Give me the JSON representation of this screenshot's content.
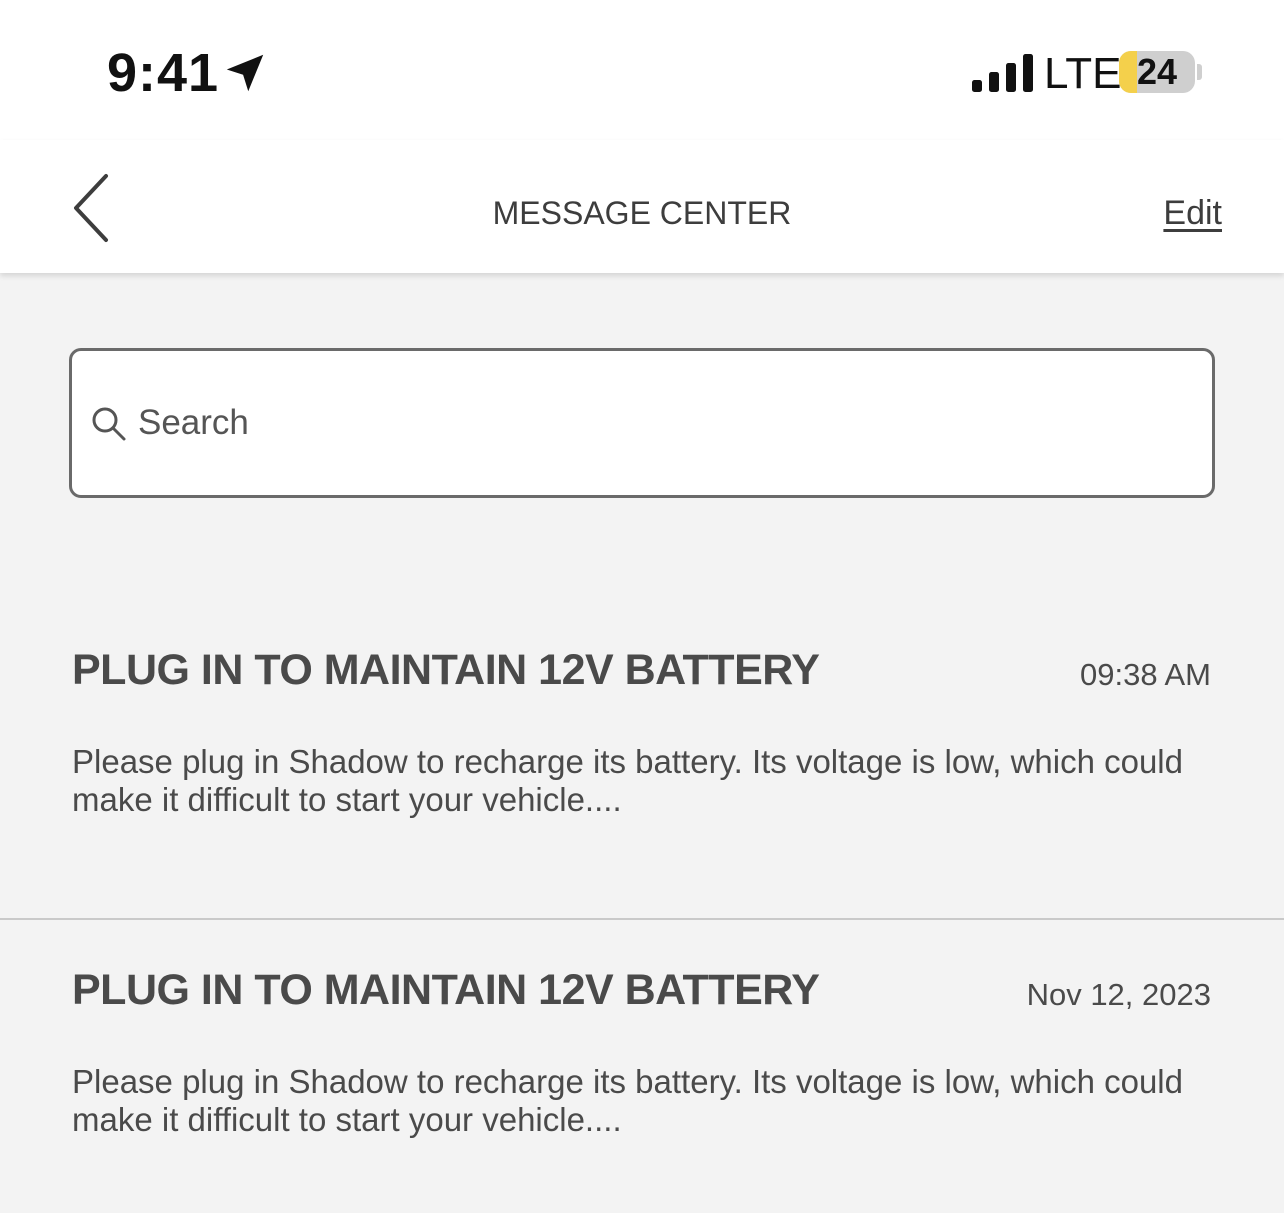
{
  "status_bar": {
    "time": "9:41",
    "network": "LTE",
    "battery_level": "24",
    "battery_fraction": 0.24
  },
  "icons": {
    "location": "location-arrow-icon",
    "signal": "cellular-signal-icon",
    "back": "chevron-left-icon",
    "search": "search-icon"
  },
  "nav": {
    "title": "MESSAGE CENTER",
    "edit_label": "Edit"
  },
  "search": {
    "placeholder": "Search",
    "value": ""
  },
  "messages": [
    {
      "title": "PLUG IN TO MAINTAIN 12V BATTERY",
      "date": "09:38 AM",
      "body": "Please plug in Shadow to recharge its battery. Its voltage is low, which could make it difficult to start your vehicle...."
    },
    {
      "title": "PLUG IN TO MAINTAIN 12V BATTERY",
      "date": "Nov 12, 2023",
      "body": "Please plug in Shadow to recharge its battery. Its voltage is low, which could make it difficult to start your vehicle...."
    }
  ],
  "colors": {
    "background": "#f3f3f3",
    "header": "#ffffff",
    "text": "#4a4a4a",
    "battery_fill": "#f4d04b"
  }
}
